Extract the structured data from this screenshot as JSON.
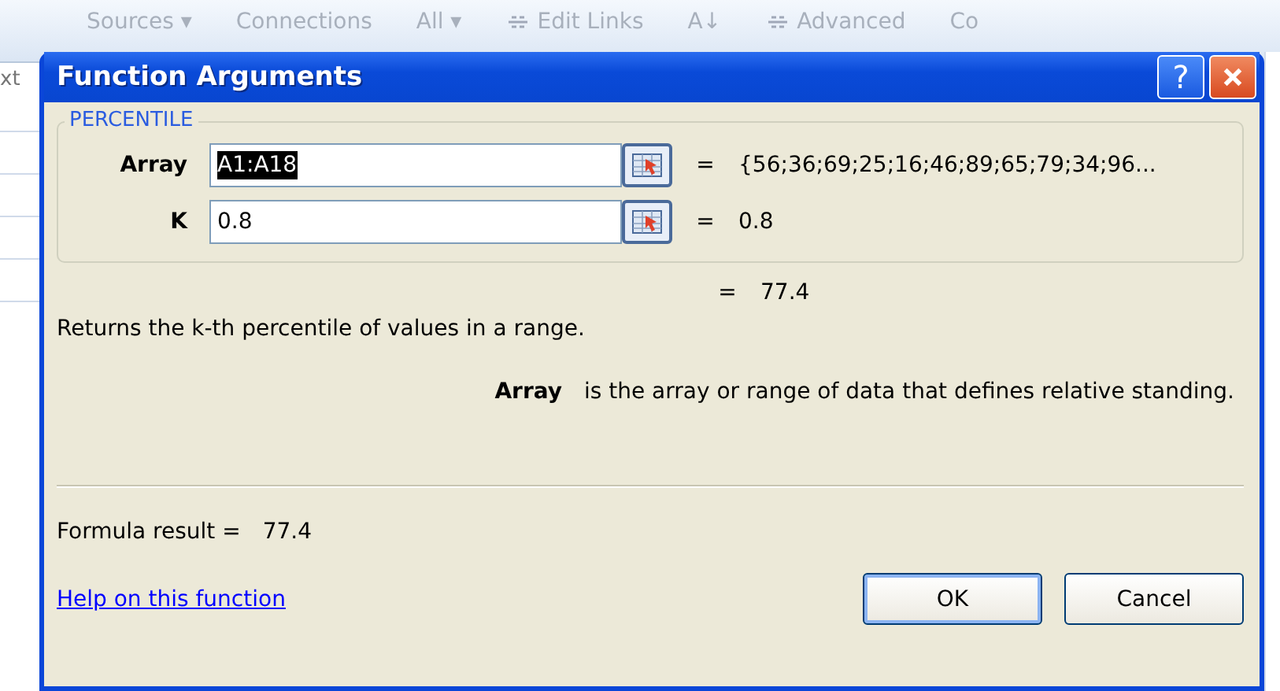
{
  "background": {
    "ribbon_labels": [
      {
        "text": "Sources ▾"
      },
      {
        "text": "Connections"
      },
      {
        "text": "All ▾"
      },
      {
        "text": "Edit Links",
        "icon": true
      },
      {
        "text": "A↓"
      },
      {
        "text": "Advanced",
        "icon": true
      },
      {
        "text": "Co"
      }
    ],
    "side_label": "xt"
  },
  "dialog": {
    "title": "Function Arguments",
    "help_glyph": "?",
    "group": {
      "title": "PERCENTILE",
      "arguments": [
        {
          "label": "Array",
          "value": "A1:A18",
          "text_selected": true,
          "equals": "=",
          "result": "{56;36;69;25;16;46;89;65;79;34;96..."
        },
        {
          "label": "K",
          "value": "0.8",
          "text_selected": false,
          "equals": "=",
          "result": "0.8"
        }
      ]
    },
    "result_equals": "=",
    "result": "77.4",
    "description": "Returns the k-th percentile of values in a range.",
    "argument_help": {
      "name": "Array",
      "text": "is the array or range of data that defines relative standing."
    },
    "formula_result_label": "Formula result =",
    "formula_result": "77.4",
    "help_link": "Help on this function",
    "buttons": [
      {
        "label": "OK",
        "default": true
      },
      {
        "label": "Cancel",
        "default": false
      }
    ]
  }
}
